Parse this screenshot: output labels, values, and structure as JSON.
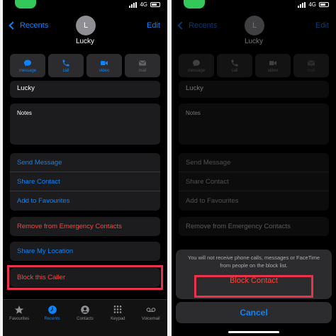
{
  "status": {
    "network": "4G"
  },
  "header": {
    "back_label": "Recents",
    "edit_label": "Edit",
    "avatar_initial": "L",
    "contact_name": "Lucky"
  },
  "actions": [
    {
      "label": "message",
      "icon": "message-bubble-icon"
    },
    {
      "label": "call",
      "icon": "phone-icon"
    },
    {
      "label": "video",
      "icon": "video-camera-icon"
    },
    {
      "label": "mail",
      "icon": "envelope-icon"
    }
  ],
  "fields": {
    "name_value": "Lucky",
    "notes_label": "Notes"
  },
  "options": {
    "send_message": "Send Message",
    "share_contact": "Share Contact",
    "add_favourites": "Add to Favourites",
    "remove_emergency": "Remove from Emergency Contacts",
    "share_location": "Share My Location",
    "block_caller": "Block this Caller"
  },
  "tabs": [
    {
      "label": "Favourites",
      "icon": "star-icon"
    },
    {
      "label": "Recents",
      "icon": "clock-icon",
      "active": true
    },
    {
      "label": "Contacts",
      "icon": "person-icon"
    },
    {
      "label": "Keypad",
      "icon": "keypad-icon"
    },
    {
      "label": "Voicemail",
      "icon": "voicemail-icon"
    }
  ],
  "sheet": {
    "message": "You will not receive phone calls, messages or FaceTime from people on the block list.",
    "block_label": "Block Contact",
    "cancel_label": "Cancel"
  },
  "colors": {
    "accent": "#0a84ff",
    "destructive": "#ff453a",
    "highlight": "#e8334a",
    "status_green": "#34c759"
  }
}
